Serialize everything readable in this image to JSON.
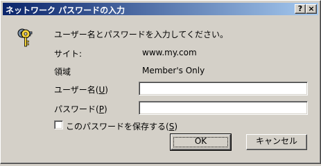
{
  "window": {
    "title": "ネットワーク パスワードの入力",
    "help_label": "?",
    "close_label": "×"
  },
  "prompt": "ユーザー名とパスワードを入力してください。",
  "site": {
    "label": "サイト:",
    "value": "www.my.com"
  },
  "realm": {
    "label": "領域",
    "value": "Member's Only"
  },
  "username": {
    "label": "ユーザー名(",
    "accel": "U",
    "label_end": ")",
    "value": ""
  },
  "password": {
    "label": "パスワード(",
    "accel": "P",
    "label_end": ")",
    "value": ""
  },
  "save_password": {
    "label": "このパスワードを保存する(",
    "accel": "S",
    "label_end": ")",
    "checked": false
  },
  "buttons": {
    "ok": "OK",
    "cancel": "キャンセル"
  },
  "icon": "keys-icon"
}
